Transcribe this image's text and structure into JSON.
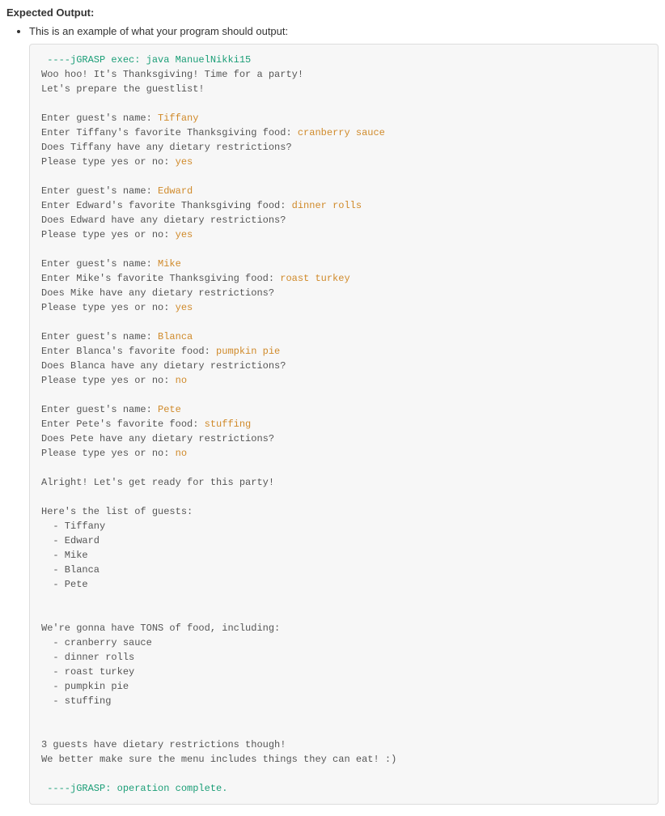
{
  "heading": "Expected Output:",
  "intro": "This is an example of what your program should output:",
  "exec_start": " ----jGRASP exec: java ManuelNikki15",
  "intro1": "Woo hoo! It's Thanksgiving! Time for a party!",
  "intro2": "Let's prepare the guestlist!",
  "guests": [
    {
      "p_name": "Enter guest's name: ",
      "name": "Tiffany",
      "p_food": "Enter Tiffany's favorite Thanksgiving food: ",
      "food": "cranberry sauce",
      "p_diet": "Does Tiffany have any dietary restrictions?",
      "p_yn": "Please type yes or no: ",
      "yn": "yes"
    },
    {
      "p_name": "Enter guest's name: ",
      "name": "Edward",
      "p_food": "Enter Edward's favorite Thanksgiving food: ",
      "food": "dinner rolls",
      "p_diet": "Does Edward have any dietary restrictions?",
      "p_yn": "Please type yes or no: ",
      "yn": "yes"
    },
    {
      "p_name": "Enter guest's name: ",
      "name": "Mike",
      "p_food": "Enter Mike's favorite Thanksgiving food: ",
      "food": "roast turkey",
      "p_diet": "Does Mike have any dietary restrictions?",
      "p_yn": "Please type yes or no: ",
      "yn": "yes"
    },
    {
      "p_name": "Enter guest's name: ",
      "name": "Blanca",
      "p_food": "Enter Blanca's favorite food: ",
      "food": "pumpkin pie",
      "p_diet": "Does Blanca have any dietary restrictions?",
      "p_yn": "Please type yes or no: ",
      "yn": "no"
    },
    {
      "p_name": "Enter guest's name: ",
      "name": "Pete",
      "p_food": "Enter Pete's favorite food: ",
      "food": "stuffing",
      "p_diet": "Does Pete have any dietary restrictions?",
      "p_yn": "Please type yes or no: ",
      "yn": "no"
    }
  ],
  "ready": "Alright! Let's get ready for this party!",
  "list_hdr": "Here's the list of guests:",
  "list_items": [
    "Tiffany",
    "Edward",
    "Mike",
    "Blanca",
    "Pete"
  ],
  "food_hdr": "We're gonna have TONS of food, including:",
  "food_items": [
    "cranberry sauce",
    "dinner rolls",
    "roast turkey",
    "pumpkin pie",
    "stuffing"
  ],
  "diet1": "3 guests have dietary restrictions though!",
  "diet2": "We better make sure the menu includes things they can eat! :)",
  "exec_end": " ----jGRASP: operation complete."
}
